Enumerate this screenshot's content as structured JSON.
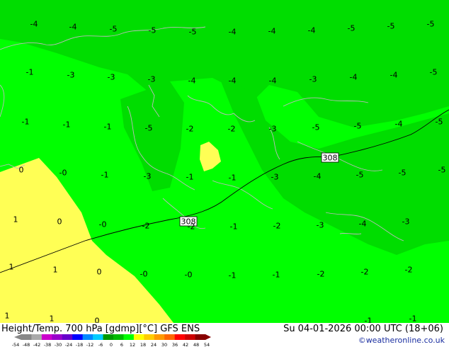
{
  "map": {
    "colors": {
      "light_green": "#00ff00",
      "dark_green": "#00dd00",
      "yellow": "#ffff55",
      "coast": "#bbbbbb",
      "contour": "#000000"
    },
    "temperature_labels": [
      "-4",
      "-4",
      "-5",
      "-5",
      "-5",
      "-4",
      "-4",
      "-4",
      "-5",
      "-5",
      "-5",
      "-1",
      "-3",
      "-3",
      "-3",
      "-4",
      "-4",
      "-4",
      "-3",
      "-4",
      "-4",
      "-5",
      "-1",
      "-1",
      "-1",
      "-5",
      "-2",
      "-2",
      "-3",
      "-5",
      "-5",
      "-4",
      "-5",
      "0",
      "-0",
      "-1",
      "-3",
      "-1",
      "-1",
      "-3",
      "-4",
      "-5",
      "-5",
      "-5",
      "1",
      "0",
      "-0",
      "-2",
      "-2",
      "-1",
      "-2",
      "-3",
      "-4",
      "-3",
      "1",
      "1",
      "0",
      "-0",
      "-0",
      "-1",
      "-1",
      "-2",
      "-2",
      "-2",
      "1",
      "1",
      "0",
      "-1",
      "-1"
    ],
    "contour_labels": [
      "308",
      "308"
    ]
  },
  "footer": {
    "left_text": "Height/Temp. 700 hPa [gdmp][°C] GFS ENS",
    "right_text": "Su 04-01-2026 00:00 UTC (18+06)",
    "credit": "©weatheronline.co.uk"
  },
  "scale": {
    "ticks": [
      "-54",
      "-48",
      "-42",
      "-38",
      "-30",
      "-24",
      "-18",
      "-12",
      "-6",
      "0",
      "6",
      "12",
      "18",
      "24",
      "30",
      "36",
      "42",
      "48",
      "54"
    ],
    "colors": [
      "#888888",
      "#aaaaaa",
      "#cc00cc",
      "#9900cc",
      "#6600cc",
      "#0000ff",
      "#0088ff",
      "#00ccff",
      "#009900",
      "#00bb00",
      "#00ff00",
      "#ffff00",
      "#ffcc00",
      "#ff9900",
      "#ff6600",
      "#ff0000",
      "#cc0000",
      "#880000"
    ]
  }
}
